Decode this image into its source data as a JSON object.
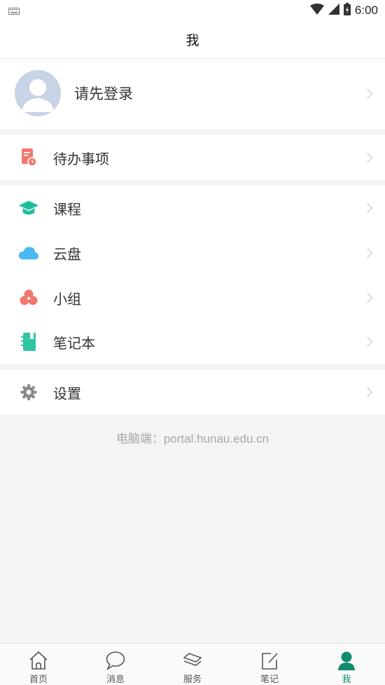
{
  "status": {
    "time": "6:00"
  },
  "header": {
    "title": "我"
  },
  "profile": {
    "login_prompt": "请先登录"
  },
  "menu": {
    "todo": "待办事项",
    "courses": "课程",
    "cloud": "云盘",
    "group": "小组",
    "notebook": "笔记本",
    "settings": "设置"
  },
  "footer_note": "电脑端：portal.hunau.edu.cn",
  "tabs": [
    {
      "label": "首页",
      "icon": "home-icon"
    },
    {
      "label": "消息",
      "icon": "message-icon"
    },
    {
      "label": "服务",
      "icon": "service-icon"
    },
    {
      "label": "笔记",
      "icon": "note-edit-icon"
    },
    {
      "label": "我",
      "icon": "person-icon",
      "active": true
    }
  ],
  "colors": {
    "accent": "#0f8c6c",
    "todo": "#f2776d",
    "course": "#1dbf9b",
    "cloud": "#4ab8f3",
    "group": "#f2776d",
    "notebook": "#2fc5a4",
    "settings": "#8a8a8a"
  }
}
